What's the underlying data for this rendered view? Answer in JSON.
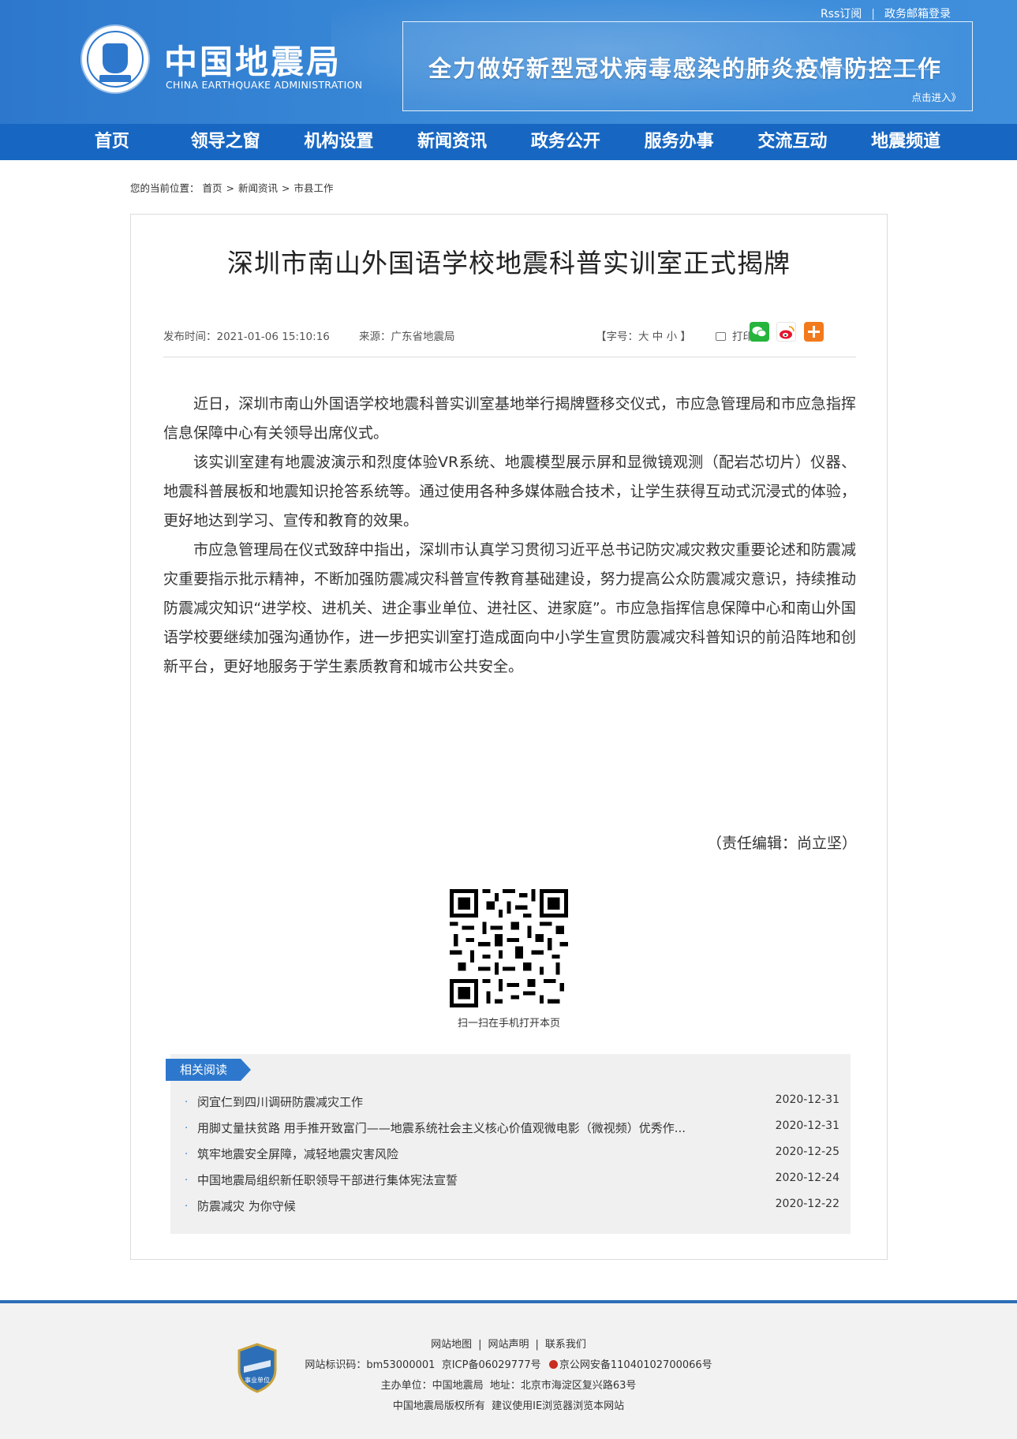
{
  "header": {
    "logo_cn": "中国地震局",
    "logo_en": "CHINA EARTHQUAKE ADMINISTRATION",
    "top_links": [
      "Rss订阅",
      "政务邮箱登录"
    ],
    "banner_title": "全力做好新型冠状病毒感染的肺炎疫情防控工作",
    "banner_enter": "点击进入》"
  },
  "nav": {
    "items": [
      "首页",
      "领导之窗",
      "机构设置",
      "新闻资讯",
      "政务公开",
      "服务办事",
      "交流互动",
      "地震频道"
    ]
  },
  "breadcrumb": {
    "prefix": "您的当前位置：",
    "items": [
      "首页",
      "新闻资讯",
      "市县工作"
    ]
  },
  "article": {
    "title": "深圳市南山外国语学校地震科普实训室正式揭牌",
    "publish_time": "发布时间：2021-01-06 15:10:16",
    "source": "来源：广东省地震局",
    "font_size_label": "【字号：大 中 小 】",
    "print_label": "打印",
    "paragraphs": [
      "近日，深圳市南山外国语学校地震科普实训室基地举行揭牌暨移交仪式，市应急管理局和市应急指挥信息保障中心有关领导出席仪式。",
      "该实训室建有地震波演示和烈度体验VR系统、地震模型展示屏和显微镜观测（配岩芯切片）仪器、地震科普展板和地震知识抢答系统等。通过使用各种多媒体融合技术，让学生获得互动式沉浸式的体验，更好地达到学习、宣传和教育的效果。",
      "市应急管理局在仪式致辞中指出，深圳市认真学习贯彻习近平总书记防灾减灾救灾重要论述和防震减灾重要指示批示精神，不断加强防震减灾科普宣传教育基础建设，努力提高公众防震减灾意识，持续推动防震减灾知识“进学校、进机关、进企事业单位、进社区、进家庭”。市应急指挥信息保障中心和南山外国语学校要继续加强沟通协作，进一步把实训室打造成面向中小学生宣贯防震减灾科普知识的前沿阵地和创新平台，更好地服务于学生素质教育和城市公共安全。"
    ],
    "editor": "（责任编辑：尚立坚）",
    "qr_caption": "扫一扫在手机打开本页"
  },
  "related": {
    "heading": "相关阅读",
    "items": [
      {
        "title": "闵宜仁到四川调研防震减灾工作",
        "date": "2020-12-31"
      },
      {
        "title": "用脚丈量扶贫路 用手推开致富门——地震系统社会主义核心价值观微电影（微视频）优秀作...",
        "date": "2020-12-31"
      },
      {
        "title": "筑牢地震安全屏障，减轻地震灾害风险",
        "date": "2020-12-25"
      },
      {
        "title": "中国地震局组织新任职领导干部进行集体宪法宣誓",
        "date": "2020-12-24"
      },
      {
        "title": "防震减灾 为你守候",
        "date": "2020-12-22"
      }
    ]
  },
  "footer": {
    "links": [
      "网站地图",
      "网站声明",
      "联系我们"
    ],
    "site_id": "网站标识码：bm53000001",
    "icp": "京ICP备06029777号",
    "police": "京公网安备11040102700066号",
    "host": "主办单位：中国地震局",
    "address": "地址：北京市海淀区复兴路63号",
    "copyright": "中国地震局版权所有",
    "browser_note": "建议使用IE浏览器浏览本网站",
    "badge_label": "事业单位"
  },
  "colors": {
    "header_blue": "#2d78cd",
    "nav_blue": "#1767c2",
    "footer_border": "#2d6db5",
    "related_bg": "#f0f0f0"
  }
}
